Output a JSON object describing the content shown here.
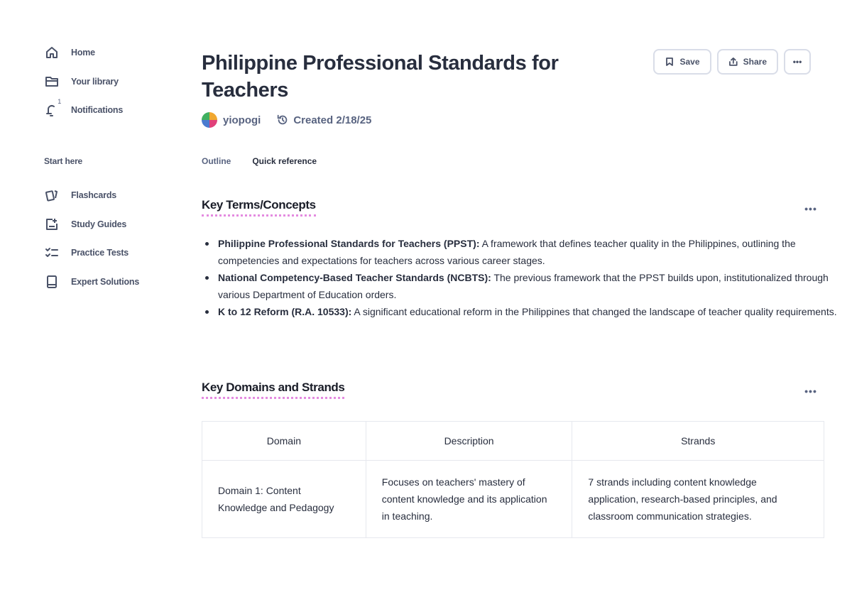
{
  "sidebar": {
    "nav": [
      {
        "label": "Home",
        "icon": "home-icon"
      },
      {
        "label": "Your library",
        "icon": "folder-icon"
      },
      {
        "label": "Notifications",
        "icon": "bell-icon",
        "badge": "1"
      }
    ],
    "section_label": "Start here",
    "tools": [
      {
        "label": "Flashcards",
        "icon": "flashcards-icon"
      },
      {
        "label": "Study Guides",
        "icon": "study-guide-icon"
      },
      {
        "label": "Practice Tests",
        "icon": "checklist-icon"
      },
      {
        "label": "Expert Solutions",
        "icon": "book-icon"
      }
    ]
  },
  "header": {
    "title": "Philippine Professional Standards for Teachers",
    "author": "yiopogi",
    "created": "Created 2/18/25",
    "save_label": "Save",
    "share_label": "Share",
    "more_label": "•••"
  },
  "tabs": [
    {
      "label": "Outline",
      "active": false
    },
    {
      "label": "Quick reference",
      "active": true
    }
  ],
  "key_terms": {
    "heading": "Key Terms/Concepts",
    "more_label": "•••",
    "items": [
      {
        "term": "Philippine Professional Standards for Teachers (PPST):",
        "definition": " A framework that defines teacher quality in the Philippines, outlining the competencies and expectations for teachers across various career stages."
      },
      {
        "term": "National Competency-Based Teacher Standards (NCBTS):",
        "definition": " The previous framework that the PPST builds upon, institutionalized through various Department of Education orders."
      },
      {
        "term": "K to 12 Reform (R.A. 10533):",
        "definition": " A significant educational reform in the Philippines that changed the landscape of teacher quality requirements."
      }
    ]
  },
  "domains": {
    "heading": "Key Domains and Strands",
    "more_label": "•••",
    "columns": [
      "Domain",
      "Description",
      "Strands"
    ],
    "rows": [
      [
        "Domain 1: Content Knowledge and Pedagogy",
        "Focuses on teachers' mastery of content knowledge and its application in teaching.",
        "7 strands including content knowledge application, research-based principles, and classroom communication strategies."
      ]
    ]
  },
  "colors": {
    "text": "#282e3e",
    "muted": "#586380",
    "accent_underline": "#e48be0",
    "border": "#d9dde8"
  }
}
